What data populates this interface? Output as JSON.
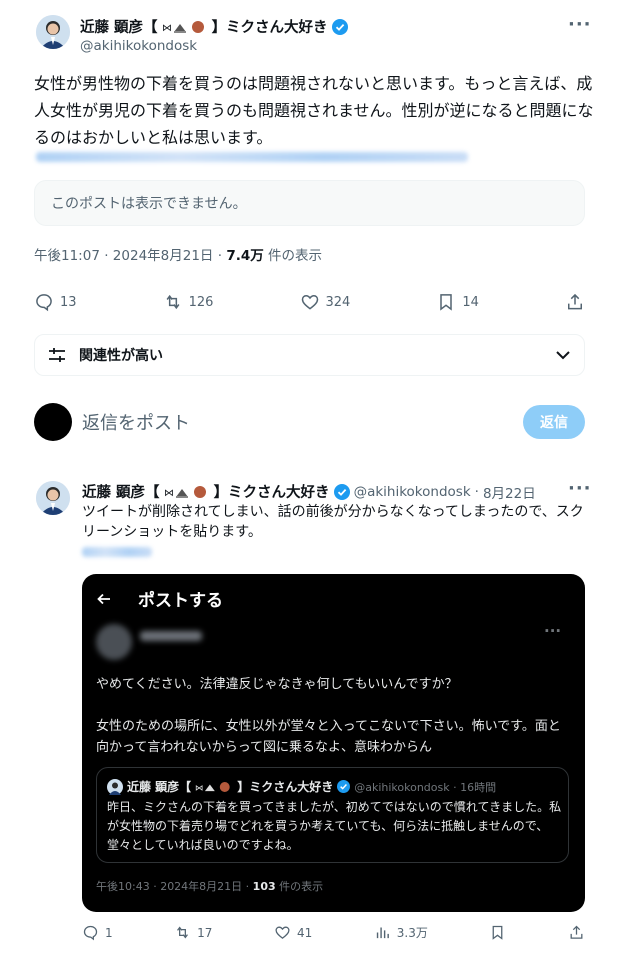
{
  "main_tweet": {
    "author": {
      "name": "近藤 顕彦【",
      "name_suffix": "】ミクさん大好き",
      "handle": "@akihikokondosk"
    },
    "text": "女性が男性物の下着を買うのは問題視されないと思います。もっと言えば、成人女性が男児の下着を買うのも問題視されません。性別が逆になると問題になるのはおかしいと私は思います。",
    "quote_unavailable": "このポストは表示できません。",
    "time": "午後11:07",
    "date": "2024年8月21日",
    "views_count": "7.4万",
    "views_label": "件の表示",
    "separator": "·",
    "stats": {
      "replies": "13",
      "reposts": "126",
      "likes": "324",
      "bookmarks": "14"
    }
  },
  "relevance": {
    "label": "関連性が高い"
  },
  "reply_box": {
    "placeholder": "返信をポスト",
    "button": "返信"
  },
  "reply_tweet": {
    "author": {
      "name": "近藤 顕彦【",
      "name_suffix": "】ミクさん大好き",
      "handle": "@akihikokondosk",
      "date": "8月22日"
    },
    "text": "ツイートが削除されてしまい、話の前後が分からなくなってしまったので、スクリーンショットを貼ります。",
    "screenshot": {
      "header_title": "ポストする",
      "body_1": "やめてください。法律違反じゃなきゃ何してもいいんですか？",
      "body_2": "女性のための場所に、女性以外が堂々と入ってこないで下さい。怖いです。面と向かって言われないからって図に乗るなよ、意味わからん",
      "quote": {
        "name": "近藤 顕彦【",
        "name_suffix": "】ミクさん大好き",
        "handle_time": "@akihikokondosk · 16時間",
        "text": "昨日、ミクさんの下着を買ってきましたが、初めてではないので慣れてきました。私が女性物の下着売り場でどれを買うか考えていても、何ら法に抵触しませんので、堂々としていれば良いのですよね。"
      },
      "meta_time": "午後10:43 · 2024年8月21日 · ",
      "meta_views": "103",
      "meta_label": " 件の表示"
    },
    "stats": {
      "replies": "1",
      "reposts": "17",
      "likes": "41",
      "views": "3.3万"
    }
  },
  "colors": {
    "accent": "#1d9bf0",
    "reply_button": "#8ecdf8",
    "muted": "#536471"
  }
}
